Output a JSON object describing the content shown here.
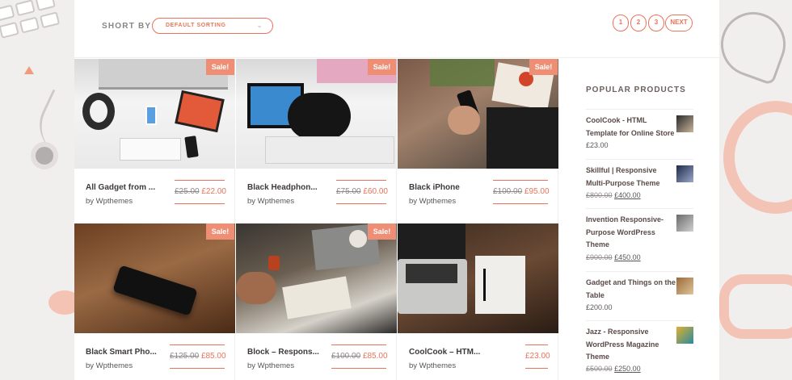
{
  "toolbar": {
    "sort_label": "SHORT BY",
    "sort_value": "DEFAULT SORTING",
    "pages": [
      "1",
      "2",
      "3"
    ],
    "next_label": "NEXT"
  },
  "sale_badge": "Sale!",
  "products": [
    {
      "name": "All Gadget from ...",
      "by": "by Wpthemes",
      "old_price": "£25.00",
      "price": "£22.00",
      "sale": true
    },
    {
      "name": "Black Headphon...",
      "by": "by Wpthemes",
      "old_price": "£75.00",
      "price": "£60.00",
      "sale": true
    },
    {
      "name": "Black iPhone",
      "by": "by Wpthemes",
      "old_price": "£100.00",
      "price": "£95.00",
      "sale": true
    },
    {
      "name": "Black Smart Pho...",
      "by": "by Wpthemes",
      "old_price": "£125.00",
      "price": "£85.00",
      "sale": true
    },
    {
      "name": "Block – Respons...",
      "by": "by Wpthemes",
      "old_price": "£100.00",
      "price": "£85.00",
      "sale": true
    },
    {
      "name": "CoolCook – HTM...",
      "by": "by Wpthemes",
      "old_price": "",
      "price": "£23.00",
      "sale": false
    }
  ],
  "sidebar": {
    "title": "POPULAR PRODUCTS",
    "items": [
      {
        "name": "CoolCook - HTML Template for Online Store",
        "old_price": "",
        "price": "£23.00"
      },
      {
        "name": "Skillful | Responsive Multi-Purpose Theme",
        "old_price": "£800.00",
        "price": "£400.00"
      },
      {
        "name": "Invention Responsive-Purpose WordPress Theme",
        "old_price": "£900.00",
        "price": "£450.00"
      },
      {
        "name": "Gadget and Things on the Table",
        "old_price": "",
        "price": "£200.00"
      },
      {
        "name": "Jazz - Responsive WordPress Magazine Theme",
        "old_price": "£500.00",
        "price": "£250.00"
      }
    ]
  },
  "colors": {
    "accent": "#e8735a",
    "sale_badge": "#ee8f75"
  }
}
